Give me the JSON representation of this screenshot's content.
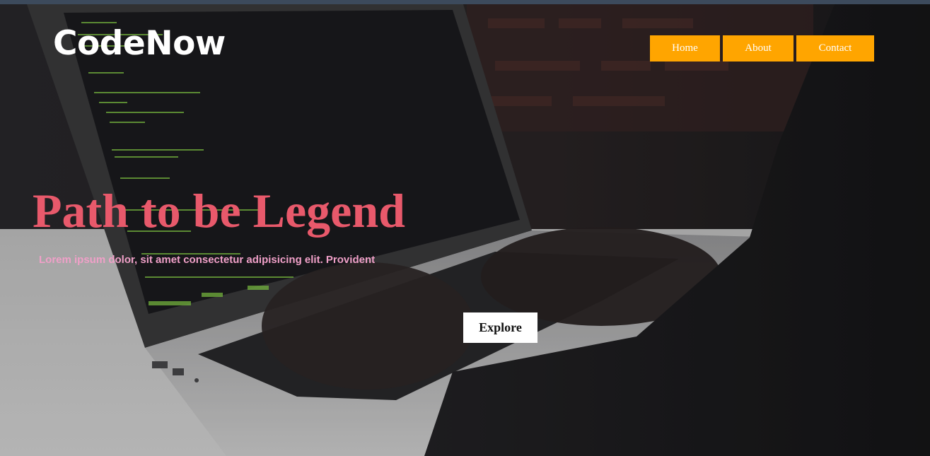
{
  "brand": {
    "name": "CodeNow"
  },
  "nav": {
    "items": [
      {
        "label": "Home"
      },
      {
        "label": "About"
      },
      {
        "label": "Contact"
      }
    ],
    "color": "#ffa500"
  },
  "hero": {
    "headline": "Path to be Legend",
    "tagline": "Lorem ipsum dolor, sit amet consectetur adipisicing elit. Provident",
    "cta_label": "Explore",
    "headline_color": "#e8596b",
    "tagline_color": "#f0a0c8"
  },
  "background": {
    "image_subject": "person typing code on laptop"
  }
}
